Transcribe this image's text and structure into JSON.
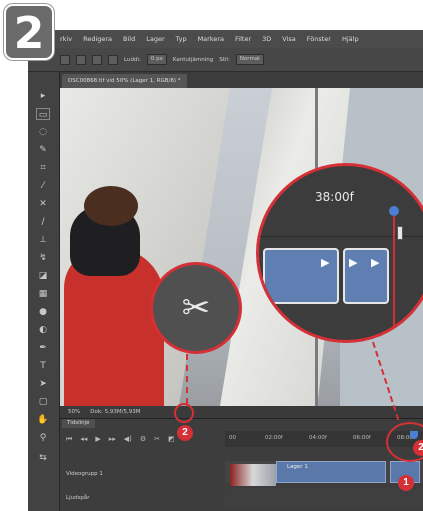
{
  "step": "2",
  "menu": [
    "rkiv",
    "Redigera",
    "Bild",
    "Lager",
    "Typ",
    "Markera",
    "Filter",
    "3D",
    "Visa",
    "Fönster",
    "Hjälp"
  ],
  "options": {
    "feather_label": "Luddi:",
    "feather_value": "0 px",
    "antialias": "Kantutjämning",
    "style_label": "Stil:",
    "style_value": "Normal"
  },
  "document_tab": "DSC00868.tif vid 50% (Lager 1, RGB/8) *",
  "status": {
    "zoom": "50%",
    "doc": "Dok: 5,93M/5,93M"
  },
  "timeline": {
    "tab_label": "Tidslinje",
    "ruler_ticks": [
      "00",
      "02:00f",
      "04:00f",
      "06:00f",
      "08:00f"
    ],
    "tracks": [
      {
        "label": "Videogrupp 1",
        "clip": "Lager 1"
      },
      {
        "label": "Ljudspår"
      }
    ]
  },
  "callout_big": {
    "timecode": "38:00f"
  },
  "callout_small": {
    "icon": "scissors-icon"
  },
  "badges": [
    "1",
    "2"
  ],
  "colors": {
    "accent": "#d43035",
    "clip": "#5f7fb3",
    "playhead": "#4a7fd3"
  }
}
